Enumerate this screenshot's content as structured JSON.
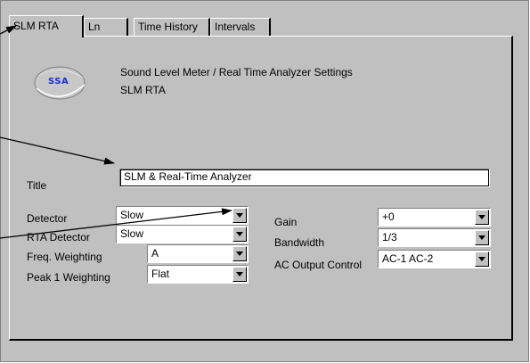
{
  "tabs": [
    {
      "label": "SLM RTA",
      "active": true
    },
    {
      "label": "Ln",
      "active": false
    },
    {
      "label": "Time History",
      "active": false
    },
    {
      "label": "Intervals",
      "active": false
    }
  ],
  "header": {
    "logo_text": "SSA",
    "line1": "Sound Level Meter / Real Time Analyzer Settings",
    "line2": "SLM RTA"
  },
  "title_field": {
    "label": "Title",
    "value": "SLM & Real-Time Analyzer"
  },
  "left_settings": {
    "detector": {
      "label": "Detector",
      "value": "Slow"
    },
    "rta_detector": {
      "label": "RTA Detector",
      "value": "Slow"
    },
    "freq_weighting": {
      "label": "Freq. Weighting",
      "value": "A"
    },
    "peak1_weighting": {
      "label": "Peak 1 Weighting",
      "value": "Flat"
    }
  },
  "right_settings": {
    "gain": {
      "label": "Gain",
      "value": "+0"
    },
    "bandwidth": {
      "label": "Bandwidth",
      "value": "1/3"
    },
    "ac_output": {
      "label": "AC Output Control",
      "value": "AC-1 AC-2"
    }
  },
  "colors": {
    "dialog_bg": "#c0c0c0",
    "logo_text": "#1a2fd4",
    "field_bg": "#ffffff"
  },
  "icons": {
    "dropdown": "triangle-down",
    "logo": "ssa-logo",
    "annotation": "arrow"
  }
}
